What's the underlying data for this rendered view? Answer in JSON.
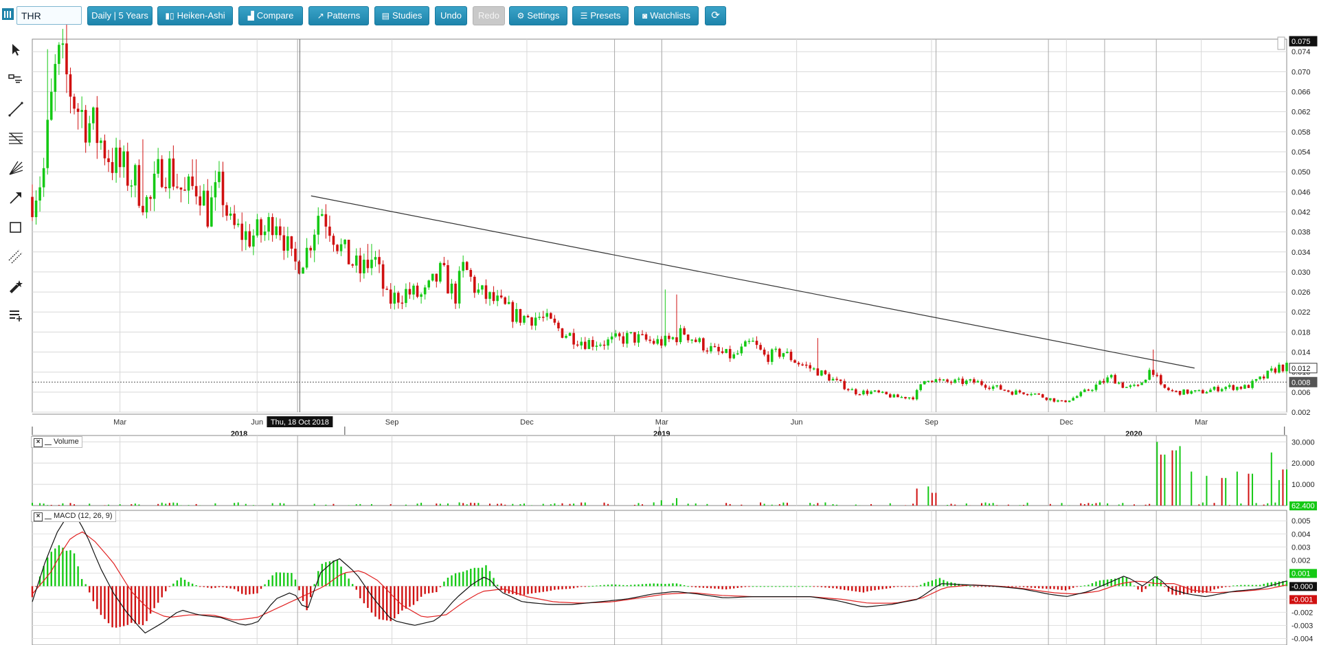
{
  "toolbar": {
    "symbol": "THR",
    "period_label": "Daily | 5 Years",
    "heikin_label": "Heiken-Ashi",
    "compare_label": "Compare",
    "patterns_label": "Patterns",
    "studies_label": "Studies",
    "undo_label": "Undo",
    "redo_label": "Redo",
    "settings_label": "Settings",
    "presets_label": "Presets",
    "watchlists_label": "Watchlists"
  },
  "tools": [
    "cursor-icon",
    "crosshair-icon",
    "line-tool-icon",
    "fibonacci-icon",
    "gann-fan-icon",
    "arrow-tool-icon",
    "rectangle-tool-icon",
    "channel-tool-icon",
    "pen-tool-icon",
    "text-tool-icon"
  ],
  "colors": {
    "up": "#15c915",
    "down": "#d01010",
    "macd_signal": "#e02020",
    "macd_line": "#111111",
    "accent": "#2593bb"
  },
  "chart_data": {
    "type": "candlestick",
    "main": {
      "y_ticks": [
        "0.074",
        "0.070",
        "0.066",
        "0.062",
        "0.058",
        "0.054",
        "0.050",
        "0.046",
        "0.042",
        "0.038",
        "0.034",
        "0.030",
        "0.026",
        "0.022",
        "0.018",
        "0.014",
        "0.010",
        "0.006",
        "0.002"
      ],
      "ylim": [
        0.002,
        0.0765
      ],
      "x_month_labels": [
        {
          "label": "Mar",
          "m": 1.95
        },
        {
          "label": "Jun",
          "m": 5
        },
        {
          "label": "Sep",
          "m": 8
        },
        {
          "label": "Dec",
          "m": 11
        },
        {
          "label": "Mar",
          "m": 14
        },
        {
          "label": "Jun",
          "m": 17
        },
        {
          "label": "Sep",
          "m": 20
        },
        {
          "label": "Dec",
          "m": 23
        },
        {
          "label": "Mar",
          "m": 26
        },
        {
          "label": "Jun",
          "m": 29
        }
      ],
      "x_year_labels": [
        {
          "label": "2018",
          "m": 4.6
        },
        {
          "label": "2019",
          "m": 14
        },
        {
          "label": "2020",
          "m": 24.5
        }
      ],
      "crosshair_date": "Thu, 18 Oct 2018",
      "badges": {
        "top": "0.075",
        "trend": "0.012",
        "last": "0.008"
      },
      "last_price": 0.008,
      "trendline": [
        {
          "m": 6.2,
          "v": 0.0452
        },
        {
          "m": 25.85,
          "v": 0.0108
        }
      ],
      "anchors": [
        {
          "m": 0,
          "v": 0.045
        },
        {
          "m": 0.25,
          "v": 0.05
        },
        {
          "m": 0.4,
          "v": 0.062
        },
        {
          "m": 0.55,
          "v": 0.072
        },
        {
          "m": 0.7,
          "v": 0.07
        },
        {
          "m": 1.0,
          "v": 0.063
        },
        {
          "m": 1.4,
          "v": 0.058
        },
        {
          "m": 1.8,
          "v": 0.052
        },
        {
          "m": 2.3,
          "v": 0.048
        },
        {
          "m": 2.6,
          "v": 0.043
        },
        {
          "m": 2.9,
          "v": 0.052
        },
        {
          "m": 3.1,
          "v": 0.05
        },
        {
          "m": 3.4,
          "v": 0.045
        },
        {
          "m": 3.7,
          "v": 0.048
        },
        {
          "m": 3.9,
          "v": 0.042
        },
        {
          "m": 4.2,
          "v": 0.047
        },
        {
          "m": 4.4,
          "v": 0.039
        },
        {
          "m": 4.8,
          "v": 0.037
        },
        {
          "m": 5.2,
          "v": 0.038
        },
        {
          "m": 5.4,
          "v": 0.042
        },
        {
          "m": 5.6,
          "v": 0.037
        },
        {
          "m": 5.8,
          "v": 0.031
        },
        {
          "m": 6.1,
          "v": 0.034
        },
        {
          "m": 6.4,
          "v": 0.043
        },
        {
          "m": 6.6,
          "v": 0.04
        },
        {
          "m": 6.9,
          "v": 0.034
        },
        {
          "m": 7.3,
          "v": 0.03
        },
        {
          "m": 7.6,
          "v": 0.033
        },
        {
          "m": 7.9,
          "v": 0.024
        },
        {
          "m": 8.3,
          "v": 0.026
        },
        {
          "m": 8.7,
          "v": 0.025
        },
        {
          "m": 9.1,
          "v": 0.03
        },
        {
          "m": 9.4,
          "v": 0.025
        },
        {
          "m": 9.6,
          "v": 0.031
        },
        {
          "m": 9.9,
          "v": 0.026
        },
        {
          "m": 10.3,
          "v": 0.024
        },
        {
          "m": 10.8,
          "v": 0.021
        },
        {
          "m": 11.3,
          "v": 0.021
        },
        {
          "m": 11.8,
          "v": 0.018
        },
        {
          "m": 12.3,
          "v": 0.016
        },
        {
          "m": 12.8,
          "v": 0.016
        },
        {
          "m": 13.3,
          "v": 0.017
        },
        {
          "m": 13.8,
          "v": 0.016
        },
        {
          "m": 14.1,
          "v": 0.016
        },
        {
          "m": 14.5,
          "v": 0.018
        },
        {
          "m": 14.8,
          "v": 0.016
        },
        {
          "m": 15.2,
          "v": 0.014
        },
        {
          "m": 15.6,
          "v": 0.013
        },
        {
          "m": 16.0,
          "v": 0.016
        },
        {
          "m": 16.3,
          "v": 0.013
        },
        {
          "m": 16.7,
          "v": 0.014
        },
        {
          "m": 17.0,
          "v": 0.012
        },
        {
          "m": 17.5,
          "v": 0.01
        },
        {
          "m": 17.9,
          "v": 0.008
        },
        {
          "m": 18.3,
          "v": 0.006
        },
        {
          "m": 18.7,
          "v": 0.006
        },
        {
          "m": 19.2,
          "v": 0.005
        },
        {
          "m": 19.6,
          "v": 0.005
        },
        {
          "m": 19.9,
          "v": 0.009
        },
        {
          "m": 20.2,
          "v": 0.008
        },
        {
          "m": 20.6,
          "v": 0.008
        },
        {
          "m": 21.0,
          "v": 0.008
        },
        {
          "m": 21.4,
          "v": 0.007
        },
        {
          "m": 21.8,
          "v": 0.006
        },
        {
          "m": 22.2,
          "v": 0.006
        },
        {
          "m": 22.5,
          "v": 0.005
        },
        {
          "m": 22.9,
          "v": 0.004
        },
        {
          "m": 23.2,
          "v": 0.005
        },
        {
          "m": 23.6,
          "v": 0.007
        },
        {
          "m": 24.0,
          "v": 0.009
        },
        {
          "m": 24.3,
          "v": 0.007
        },
        {
          "m": 24.6,
          "v": 0.007
        },
        {
          "m": 24.9,
          "v": 0.011
        },
        {
          "m": 25.1,
          "v": 0.007
        },
        {
          "m": 25.4,
          "v": 0.006
        },
        {
          "m": 25.7,
          "v": 0.006
        },
        {
          "m": 26.0,
          "v": 0.006
        },
        {
          "m": 26.5,
          "v": 0.007
        },
        {
          "m": 27.0,
          "v": 0.007
        },
        {
          "m": 27.4,
          "v": 0.009
        },
        {
          "m": 27.7,
          "v": 0.011
        }
      ],
      "spikes": [
        {
          "m": 0.35,
          "high": 0.0745
        },
        {
          "m": 2.45,
          "high": 0.0565
        },
        {
          "m": 3.6,
          "high": 0.0525
        },
        {
          "m": 7.5,
          "high": 0.0356
        },
        {
          "m": 14.1,
          "high": 0.0265
        },
        {
          "m": 14.3,
          "high": 0.0255
        },
        {
          "m": 17.5,
          "high": 0.0168
        },
        {
          "m": 24.9,
          "high": 0.0145
        }
      ]
    },
    "volume": {
      "title": "Volume",
      "y_ticks": [
        "30.000",
        "20.000",
        "10.000"
      ],
      "ylim": [
        0,
        33000
      ],
      "badge": "62.400",
      "spikes": [
        {
          "m": 14.0,
          "v": 2500
        },
        {
          "m": 14.3,
          "v": 3500
        },
        {
          "m": 19.7,
          "v": 8000
        },
        {
          "m": 19.9,
          "v": 9000
        },
        {
          "m": 20.05,
          "v": 6000
        },
        {
          "m": 25.0,
          "v": 30000
        },
        {
          "m": 25.15,
          "v": 24000
        },
        {
          "m": 25.4,
          "v": 26000
        },
        {
          "m": 25.55,
          "v": 28000
        },
        {
          "m": 25.8,
          "v": 16000
        },
        {
          "m": 26.1,
          "v": 14000
        },
        {
          "m": 26.5,
          "v": 13000
        },
        {
          "m": 26.8,
          "v": 16000
        },
        {
          "m": 27.1,
          "v": 15000
        },
        {
          "m": 27.55,
          "v": 25000
        },
        {
          "m": 27.7,
          "v": 12000
        },
        {
          "m": 27.85,
          "v": 17000
        }
      ]
    },
    "macd": {
      "title": "MACD (12, 26, 9)",
      "y_ticks": [
        "0.005",
        "0.004",
        "0.003",
        "0.002",
        "0.001",
        "0.000",
        "-0.001",
        "-0.002",
        "-0.003",
        "-0.004"
      ],
      "ylim": [
        -0.0045,
        0.0058
      ],
      "badges": {
        "hist": "0.001",
        "line": "-0.000",
        "signal": "-0.001"
      },
      "macd_line": [
        {
          "m": 0,
          "v": -0.0012
        },
        {
          "m": 0.3,
          "v": 0.002
        },
        {
          "m": 0.6,
          "v": 0.0045
        },
        {
          "m": 0.9,
          "v": 0.0058
        },
        {
          "m": 1.2,
          "v": 0.004
        },
        {
          "m": 1.5,
          "v": 0.0015
        },
        {
          "m": 1.8,
          "v": -0.0005
        },
        {
          "m": 2.1,
          "v": -0.002
        },
        {
          "m": 2.5,
          "v": -0.0036
        },
        {
          "m": 2.9,
          "v": -0.0028
        },
        {
          "m": 3.3,
          "v": -0.0018
        },
        {
          "m": 3.7,
          "v": -0.0022
        },
        {
          "m": 4.2,
          "v": -0.0024
        },
        {
          "m": 4.7,
          "v": -0.003
        },
        {
          "m": 5.0,
          "v": -0.0028
        },
        {
          "m": 5.4,
          "v": -0.001
        },
        {
          "m": 5.8,
          "v": -0.0004
        },
        {
          "m": 6.1,
          "v": -0.002
        },
        {
          "m": 6.4,
          "v": 0.001
        },
        {
          "m": 6.8,
          "v": 0.0022
        },
        {
          "m": 7.2,
          "v": 0.001
        },
        {
          "m": 7.6,
          "v": -0.001
        },
        {
          "m": 8.0,
          "v": -0.0026
        },
        {
          "m": 8.5,
          "v": -0.003
        },
        {
          "m": 9.0,
          "v": -0.0026
        },
        {
          "m": 9.4,
          "v": -0.001
        },
        {
          "m": 9.8,
          "v": 0.0002
        },
        {
          "m": 10.1,
          "v": 0.0008
        },
        {
          "m": 10.4,
          "v": -0.0004
        },
        {
          "m": 10.9,
          "v": -0.0012
        },
        {
          "m": 11.5,
          "v": -0.0014
        },
        {
          "m": 12.0,
          "v": -0.0014
        },
        {
          "m": 12.6,
          "v": -0.0012
        },
        {
          "m": 13.2,
          "v": -0.001
        },
        {
          "m": 13.8,
          "v": -0.0006
        },
        {
          "m": 14.3,
          "v": -0.0004
        },
        {
          "m": 14.8,
          "v": -0.0006
        },
        {
          "m": 15.4,
          "v": -0.0009
        },
        {
          "m": 16.0,
          "v": -0.0008
        },
        {
          "m": 16.7,
          "v": -0.0008
        },
        {
          "m": 17.3,
          "v": -0.0008
        },
        {
          "m": 17.9,
          "v": -0.0011
        },
        {
          "m": 18.5,
          "v": -0.0016
        },
        {
          "m": 19.1,
          "v": -0.0014
        },
        {
          "m": 19.7,
          "v": -0.001
        },
        {
          "m": 20.2,
          "v": 0.0002
        },
        {
          "m": 20.8,
          "v": 0.0001
        },
        {
          "m": 21.4,
          "v": 0
        },
        {
          "m": 22.0,
          "v": -0.0002
        },
        {
          "m": 22.6,
          "v": -0.0006
        },
        {
          "m": 23.0,
          "v": -0.0008
        },
        {
          "m": 23.5,
          "v": -0.0004
        },
        {
          "m": 23.9,
          "v": 0.0002
        },
        {
          "m": 24.3,
          "v": 0.0008
        },
        {
          "m": 24.7,
          "v": 0
        },
        {
          "m": 25.0,
          "v": 0.0008
        },
        {
          "m": 25.3,
          "v": -0.0002
        },
        {
          "m": 25.7,
          "v": -0.0006
        },
        {
          "m": 26.1,
          "v": -0.0008
        },
        {
          "m": 26.7,
          "v": -0.0004
        },
        {
          "m": 27.3,
          "v": -0.0002
        },
        {
          "m": 27.7,
          "v": 0.0002
        },
        {
          "m": 27.9,
          "v": 0.0004
        }
      ],
      "signal_line": [
        {
          "m": 0,
          "v": -0.0006
        },
        {
          "m": 0.4,
          "v": 0.001
        },
        {
          "m": 0.8,
          "v": 0.0035
        },
        {
          "m": 1.1,
          "v": 0.0042
        },
        {
          "m": 1.4,
          "v": 0.0034
        },
        {
          "m": 1.8,
          "v": 0.0018
        },
        {
          "m": 2.2,
          "v": -0.0004
        },
        {
          "m": 2.6,
          "v": -0.0018
        },
        {
          "m": 3.0,
          "v": -0.0024
        },
        {
          "m": 3.5,
          "v": -0.0022
        },
        {
          "m": 4.0,
          "v": -0.0022
        },
        {
          "m": 4.5,
          "v": -0.0026
        },
        {
          "m": 5.0,
          "v": -0.0024
        },
        {
          "m": 5.5,
          "v": -0.0016
        },
        {
          "m": 6.0,
          "v": -0.0008
        },
        {
          "m": 6.5,
          "v": 0
        },
        {
          "m": 6.9,
          "v": 0.001
        },
        {
          "m": 7.3,
          "v": 0.0012
        },
        {
          "m": 7.7,
          "v": 0.0004
        },
        {
          "m": 8.2,
          "v": -0.0014
        },
        {
          "m": 8.7,
          "v": -0.0024
        },
        {
          "m": 9.2,
          "v": -0.0022
        },
        {
          "m": 9.6,
          "v": -0.0012
        },
        {
          "m": 10.0,
          "v": -0.0004
        },
        {
          "m": 10.5,
          "v": -0.0002
        },
        {
          "m": 11.0,
          "v": -0.0008
        },
        {
          "m": 11.6,
          "v": -0.0012
        },
        {
          "m": 12.2,
          "v": -0.0013
        },
        {
          "m": 12.9,
          "v": -0.0012
        },
        {
          "m": 13.5,
          "v": -0.0009
        },
        {
          "m": 14.1,
          "v": -0.0006
        },
        {
          "m": 14.7,
          "v": -0.0005
        },
        {
          "m": 15.3,
          "v": -0.0007
        },
        {
          "m": 16.0,
          "v": -0.0008
        },
        {
          "m": 16.7,
          "v": -0.0008
        },
        {
          "m": 17.3,
          "v": -0.0008
        },
        {
          "m": 18.0,
          "v": -0.001
        },
        {
          "m": 18.6,
          "v": -0.0013
        },
        {
          "m": 19.2,
          "v": -0.0013
        },
        {
          "m": 19.8,
          "v": -0.0009
        },
        {
          "m": 20.3,
          "v": -0.0001
        },
        {
          "m": 20.9,
          "v": 0.0001
        },
        {
          "m": 21.5,
          "v": 0
        },
        {
          "m": 22.1,
          "v": -0.0002
        },
        {
          "m": 22.7,
          "v": -0.0005
        },
        {
          "m": 23.2,
          "v": -0.0006
        },
        {
          "m": 23.7,
          "v": -0.0004
        },
        {
          "m": 24.2,
          "v": 0.0002
        },
        {
          "m": 24.6,
          "v": 0.0004
        },
        {
          "m": 25.0,
          "v": 0.0002
        },
        {
          "m": 25.4,
          "v": 0.0002
        },
        {
          "m": 25.8,
          "v": -0.0003
        },
        {
          "m": 26.3,
          "v": -0.0005
        },
        {
          "m": 26.9,
          "v": -0.0004
        },
        {
          "m": 27.5,
          "v": -0.0002
        },
        {
          "m": 27.9,
          "v": 0.0001
        }
      ]
    }
  }
}
